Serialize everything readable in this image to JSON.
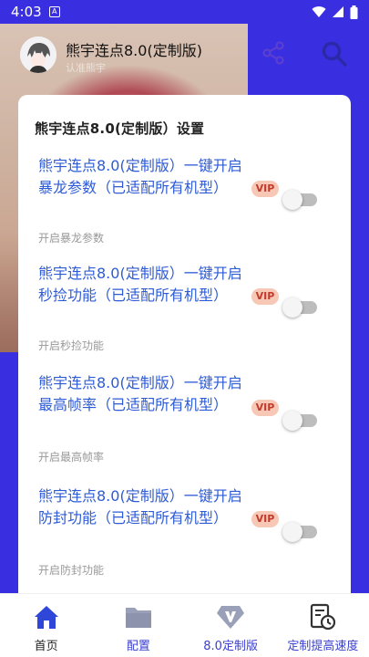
{
  "status": {
    "time": "4:03",
    "notif": "A"
  },
  "header": {
    "title": "熊宇连点8.0(定制版)",
    "subtitle": "认准熊宇"
  },
  "card": {
    "title": "熊宇连点8.0(定制版）设置",
    "items": [
      {
        "text": "熊宇连点8.0(定制版）一键开启暴龙参数（已适配所有机型）",
        "desc": "开启暴龙参数",
        "badge": "VIP"
      },
      {
        "text": "熊宇连点8.0(定制版）一键开启秒捡功能（已适配所有机型）",
        "desc": "开启秒捡功能",
        "badge": "VIP"
      },
      {
        "text": "熊宇连点8.0(定制版）一键开启最高帧率（已适配所有机型）",
        "desc": "开启最高帧率",
        "badge": "VIP"
      },
      {
        "text": "熊宇连点8.0(定制版）一键开启防封功能（已适配所有机型）",
        "desc": "开启防封功能",
        "badge": "VIP"
      }
    ]
  },
  "nav": [
    {
      "label": "首页"
    },
    {
      "label": "配置"
    },
    {
      "label": "8.0定制版"
    },
    {
      "label": "定制提高速度"
    }
  ],
  "colors": {
    "primary": "#3a2fe0",
    "link": "#2e5bd6",
    "vip_bg": "#f6c8b5",
    "vip_text": "#c23a2c"
  }
}
